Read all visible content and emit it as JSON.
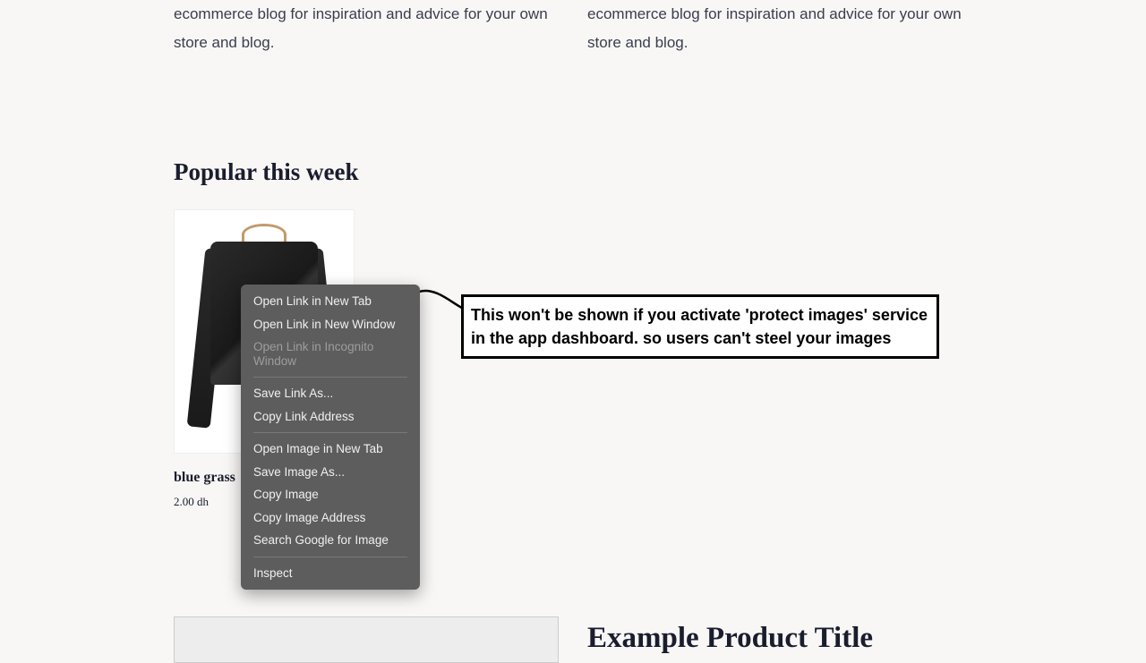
{
  "blog": {
    "left": "ecommerce blog for inspiration and advice for your own store and blog.",
    "right": "ecommerce blog for inspiration and advice for your own store and blog."
  },
  "popular": {
    "heading": "Popular this week",
    "product": {
      "title": "blue grass",
      "price": "2.00 dh"
    }
  },
  "example": {
    "title": "Example Product Title"
  },
  "context_menu": {
    "items": [
      {
        "label": "Open Link in New Tab",
        "disabled": false
      },
      {
        "label": "Open Link in New Window",
        "disabled": false
      },
      {
        "label": "Open Link in Incognito Window",
        "disabled": true
      }
    ],
    "items2": [
      {
        "label": "Save Link As...",
        "disabled": false
      },
      {
        "label": "Copy Link Address",
        "disabled": false
      }
    ],
    "items3": [
      {
        "label": "Open Image in New Tab",
        "disabled": false
      },
      {
        "label": "Save Image As...",
        "disabled": false
      },
      {
        "label": "Copy Image",
        "disabled": false
      },
      {
        "label": "Copy Image Address",
        "disabled": false
      },
      {
        "label": "Search Google for Image",
        "disabled": false
      }
    ],
    "items4": [
      {
        "label": "Inspect",
        "disabled": false
      }
    ]
  },
  "callout": {
    "text": "This won't be shown if you activate 'protect images' service in the app dashboard. so users can't steel your images"
  }
}
